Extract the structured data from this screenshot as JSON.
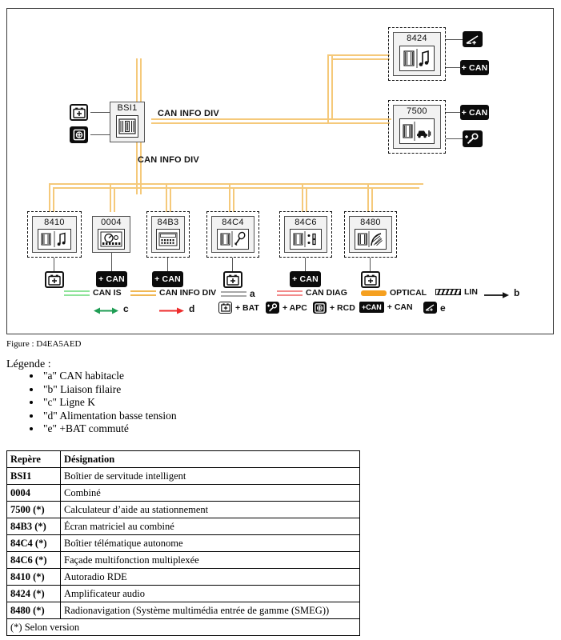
{
  "figure": {
    "caption": "Figure : D4EA5AED",
    "legende_title": "Légende :",
    "legende_items": [
      "\"a\" CAN habitacle",
      "\"b\" Liaison filaire",
      "\"c\" Ligne K",
      "\"d\" Alimentation basse tension",
      "\"e\" +BAT commuté"
    ]
  },
  "diagram": {
    "bus_labels": {
      "upper": "CAN INFO DIV",
      "lower": "CAN INFO DIV"
    },
    "bsi": {
      "label": "BSI1",
      "bat_icon": "battery-plus-icon",
      "rcd_icon": "rcd-icon"
    },
    "right_nodes": [
      {
        "label": "8424",
        "glyph": "amplifier-icon",
        "tag_top": "e-switch-icon",
        "tag_bottom": "+ CAN"
      },
      {
        "label": "7500",
        "glyph": "parking-aid-icon",
        "tag_top": "+ CAN",
        "tag_bottom": "apc-key-icon"
      }
    ],
    "bottom_nodes": [
      {
        "label": "8410",
        "glyph": "car-radio-icon",
        "supply": "+BAT",
        "supply_kind": "bat",
        "dashed": true
      },
      {
        "label": "0004",
        "glyph": "instrument-cluster-icon",
        "supply": "+ CAN",
        "supply_kind": "can",
        "dashed": false
      },
      {
        "label": "84B3",
        "glyph": "matrix-display-icon",
        "supply": "+ CAN",
        "supply_kind": "can",
        "dashed": true
      },
      {
        "label": "84C4",
        "glyph": "telematic-unit-icon",
        "supply": "+BAT",
        "supply_kind": "bat",
        "dashed": true
      },
      {
        "label": "84C6",
        "glyph": "multifunction-panel-icon",
        "supply": "+ CAN",
        "supply_kind": "can",
        "dashed": true
      },
      {
        "label": "8480",
        "glyph": "radionavigation-icon",
        "supply": "+BAT",
        "supply_kind": "bat",
        "dashed": true
      }
    ],
    "colors": {
      "can_is": "#8fe39a",
      "can_info_div": "#f0b855",
      "a_line": "#a8a8a8",
      "can_diag": "#f28b8b",
      "optical": "#f5a020",
      "lin": "#111111",
      "c_arrow": "#1f9d54",
      "d_arrow": "#ee2b2b",
      "bus": "#f5c97a",
      "wire": "#555555"
    },
    "legend": {
      "row1": [
        {
          "kind": "double",
          "color_key": "can_is",
          "text": "CAN IS"
        },
        {
          "kind": "double",
          "color_key": "can_info_div",
          "text": "CAN INFO DIV"
        },
        {
          "kind": "double",
          "color_key": "a_line",
          "text": "a",
          "letter": true
        },
        {
          "kind": "double",
          "color_key": "can_diag",
          "text": "CAN DIAG"
        },
        {
          "kind": "solid",
          "color_key": "optical",
          "text": "OPTICAL"
        },
        {
          "kind": "lin",
          "color_key": "lin",
          "text": "LIN"
        },
        {
          "kind": "arrow",
          "color_key": "lin",
          "text": "b",
          "letter": true
        }
      ],
      "row2": [
        {
          "kind": "darrow",
          "color_key": "c_arrow",
          "text": "c",
          "letter": true
        },
        {
          "kind": "arrow",
          "color_key": "d_arrow",
          "text": "d",
          "letter": true
        },
        {
          "kind": "icon-bat",
          "text": "+ BAT"
        },
        {
          "kind": "icon-apc",
          "text": "+ APC"
        },
        {
          "kind": "icon-rcd",
          "text": "+ RCD"
        },
        {
          "kind": "icon-can",
          "tag": "+CAN",
          "text": "+ CAN"
        },
        {
          "kind": "icon-e",
          "text": "e",
          "letter": true
        }
      ]
    }
  },
  "table": {
    "headers": [
      "Repère",
      "Désignation"
    ],
    "rows": [
      [
        "BSI1",
        "Boîtier de servitude intelligent"
      ],
      [
        "0004",
        "Combiné"
      ],
      [
        "7500 (*)",
        "Calculateur d’aide au stationnement"
      ],
      [
        "84B3 (*)",
        "Écran matriciel au combiné"
      ],
      [
        "84C4 (*)",
        "Boîtier télématique autonome"
      ],
      [
        "84C6 (*)",
        "Façade multifonction multiplexée"
      ],
      [
        "8410 (*)",
        "Autoradio RDE"
      ],
      [
        "8424 (*)",
        "Amplificateur audio"
      ],
      [
        "8480 (*)",
        "Radionavigation (Système multimédia entrée de gamme (SMEG))"
      ]
    ],
    "footer": "(*) Selon version"
  }
}
